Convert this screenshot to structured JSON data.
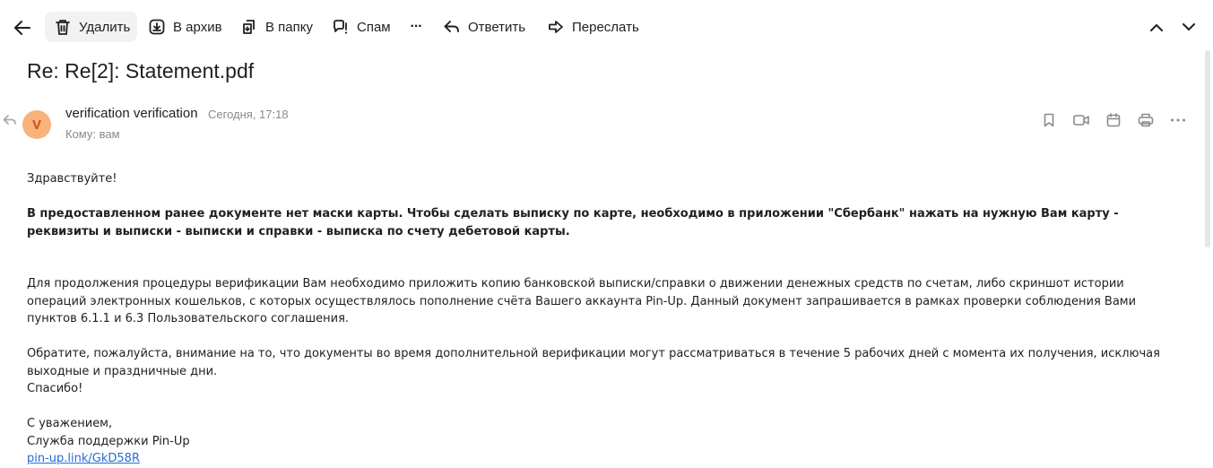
{
  "toolbar": {
    "delete": "Удалить",
    "archive": "В архив",
    "folder": "В папку",
    "spam": "Спам",
    "more": "···",
    "reply": "Ответить",
    "forward": "Переслать"
  },
  "message": {
    "subject": "Re: Re[2]: Statement.pdf",
    "avatar_letter": "V",
    "sender": "verification verification",
    "date": "Сегодня, 17:18",
    "to_label": "Кому:",
    "to_value": "вам"
  },
  "body": {
    "greeting": "Здравствуйте!",
    "bold_paragraph": "В предоставленном ранее документе нет маски карты. Чтобы сделать выписку по карте, необходимо в приложении \"Сбербанк\" нажать на нужную Вам карту - реквизиты и выписки - выписки и справки - выписка по счету дебетовой карты.",
    "paragraph1": "Для продолжения процедуры верификации Вам необходимо приложить копию банковской выписки/справки о движении денежных средств по счетам, либо скриншот истории операций электронных кошельков, с которых осуществлялось пополнение счёта Вашего аккаунта Pin-Up. Данный документ запрашивается в рамках проверки соблюдения Вами пунктов 6.1.1 и 6.3 Пользовательского соглашения.",
    "paragraph2": "Обратите, пожалуйста, внимание на то, что документы во время дополнительной верификации могут рассматриваться в течение 5 рабочих дней с момента их получения, исключая выходные и праздничные дни.",
    "thanks": "Спасибо!",
    "regards": "С уважением,",
    "signature": "Служба поддержки Pin-Up",
    "link": "pin-up.link/GkD58R"
  },
  "colors": {
    "avatar_bg": "#f8b27b",
    "avatar_text": "#c5521a",
    "link": "#2a6ccf",
    "muted": "#8a8a8e"
  },
  "icons": {
    "back": "arrow-left-icon",
    "delete": "trash-icon",
    "archive": "archive-icon",
    "folder": "move-folder-icon",
    "spam": "spam-icon",
    "reply": "reply-icon",
    "forward": "forward-icon",
    "prev": "chevron-up-icon",
    "next": "chevron-down-icon",
    "bookmark": "bookmark-icon",
    "video": "video-call-icon",
    "calendar": "calendar-icon",
    "print": "print-icon",
    "more": "more-dots-icon"
  }
}
